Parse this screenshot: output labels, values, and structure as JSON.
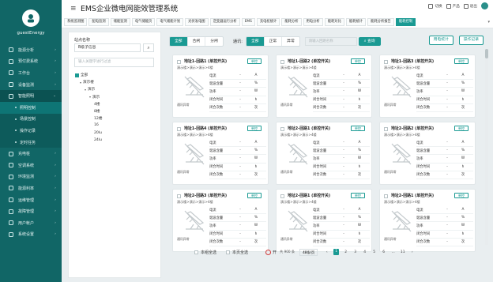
{
  "brand": {
    "name": "guestEnergy"
  },
  "header": {
    "title": "EMS企业微电网能效管理系统",
    "tools": [
      "切换",
      "产品",
      "退出"
    ],
    "tabs": [
      "系统监测图",
      "配电监测",
      "储能监测",
      "电气储能页",
      "电气储能计划",
      "光伏发电图",
      "逆变器运行分析",
      "EMS",
      "充电桩统计",
      "能耗分析",
      "用电分析",
      "能耗对比",
      "能耗统计",
      "能耗分析报告",
      "能耗控制"
    ],
    "active_tab": "能耗控制"
  },
  "sidebar": {
    "items": [
      {
        "label": "能源分析",
        "kind": "item"
      },
      {
        "label": "预付费系统",
        "kind": "item"
      },
      {
        "label": "工作台",
        "kind": "item"
      },
      {
        "label": "设备监测",
        "kind": "item"
      },
      {
        "label": "智能照明",
        "kind": "item",
        "active": true
      },
      {
        "label": "照明控制",
        "kind": "sub",
        "current": true
      },
      {
        "label": "场景控制",
        "kind": "sub"
      },
      {
        "label": "操作记录",
        "kind": "sub"
      },
      {
        "label": "定时任务",
        "kind": "sub"
      },
      {
        "label": "充电桩",
        "kind": "item"
      },
      {
        "label": "空调系统",
        "kind": "item"
      },
      {
        "label": "环境监测",
        "kind": "item"
      },
      {
        "label": "能源利率",
        "kind": "item"
      },
      {
        "label": "运维管理",
        "kind": "item"
      },
      {
        "label": "故障管理",
        "kind": "item"
      },
      {
        "label": "用户帐户",
        "kind": "item"
      },
      {
        "label": "系统设置",
        "kind": "item"
      }
    ]
  },
  "tree": {
    "station_label": "站点名称",
    "station_value": "B级子信息",
    "keyword_placeholder": "输入关键字进行过滤",
    "nodes": [
      {
        "label": "全部",
        "indent": 0,
        "checked": true,
        "caret": false
      },
      {
        "label": "演示楼",
        "indent": 1,
        "checked": false,
        "caret": true
      },
      {
        "label": "演示",
        "indent": 2,
        "checked": false,
        "caret": true
      },
      {
        "label": "演示",
        "indent": 3,
        "checked": false,
        "caret": true
      },
      {
        "label": "4楼",
        "indent": 4,
        "checked": false,
        "caret": false
      },
      {
        "label": "8楼",
        "indent": 4,
        "checked": false,
        "caret": false
      },
      {
        "label": "12楼",
        "indent": 4,
        "checked": false,
        "caret": false
      },
      {
        "label": "16",
        "indent": 4,
        "checked": false,
        "caret": false
      },
      {
        "label": "20lu",
        "indent": 4,
        "checked": false,
        "caret": false
      },
      {
        "label": "24lu",
        "indent": 4,
        "checked": false,
        "caret": false
      }
    ]
  },
  "toolbar": {
    "mode_options": [
      "全部",
      "合闸",
      "分闸"
    ],
    "mode_active": "全部",
    "comm_label": "通讯:",
    "comm_options": [
      "全部",
      "正常",
      "异常"
    ],
    "comm_active": "全部",
    "search_placeholder": "请输入回路名称",
    "query_label": "查询",
    "stats_label": "用电统计",
    "log_label": "操作记录"
  },
  "cards": [
    {
      "title": "地址1-回路1 (单控开关)",
      "sub": "演示楼>演示>演示>4楼",
      "btn": "单控",
      "status": "通讯异常"
    },
    {
      "title": "地址1-回路2 (单控开关)",
      "sub": "演示楼>演示>演示>4楼",
      "btn": "单控",
      "status": "通讯异常"
    },
    {
      "title": "地址1-回路3 (单控开关)",
      "sub": "演示楼>演示>演示>4楼",
      "btn": "单控",
      "status": "通讯异常"
    },
    {
      "title": "地址1-回路4 (单控开关)",
      "sub": "演示楼>演示>演示>4楼",
      "btn": "单控",
      "status": "通讯异常"
    },
    {
      "title": "地址2-回路1 (单控开关)",
      "sub": "演示楼>演示>演示>4楼",
      "btn": "单控",
      "status": "通讯异常"
    },
    {
      "title": "地址2-回路2 (单控开关)",
      "sub": "演示楼>演示>演示>4楼",
      "btn": "单控",
      "status": "通讯异常"
    },
    {
      "title": "地址2-回路3 (单控开关)",
      "sub": "演示楼>演示>演示>4楼",
      "btn": "单控",
      "status": "通讯异常"
    },
    {
      "title": "地址2-回路1 (单控开关)",
      "sub": "演示楼>演示>演示>4楼",
      "btn": "单控",
      "status": "通讯异常"
    },
    {
      "title": "地址2-回路1 (单控开关)",
      "sub": "演示楼>演示>演示>4楼",
      "btn": "单控",
      "status": "通讯异常"
    }
  ],
  "metrics": [
    {
      "label": "电流",
      "value": "-",
      "unit": "A"
    },
    {
      "label": "谐波含量",
      "value": "-",
      "unit": "%"
    },
    {
      "label": "功率",
      "value": "-",
      "unit": "W"
    },
    {
      "label": "闭合时间",
      "value": "-",
      "unit": "h"
    },
    {
      "label": "闭合次数",
      "value": "-",
      "unit": "次"
    }
  ],
  "footer": {
    "select_page": "本组全选",
    "select_current": "本页全选",
    "power_on": "开",
    "power_total": "共 900 条",
    "page_size": "48条/页",
    "pages": [
      "1",
      "2",
      "3",
      "4",
      "5",
      "6",
      "...",
      "11"
    ],
    "current_page": "1"
  },
  "colors": {
    "sidebar": "#116666",
    "accent": "#1a9a93",
    "alert": "#d23b3b"
  }
}
